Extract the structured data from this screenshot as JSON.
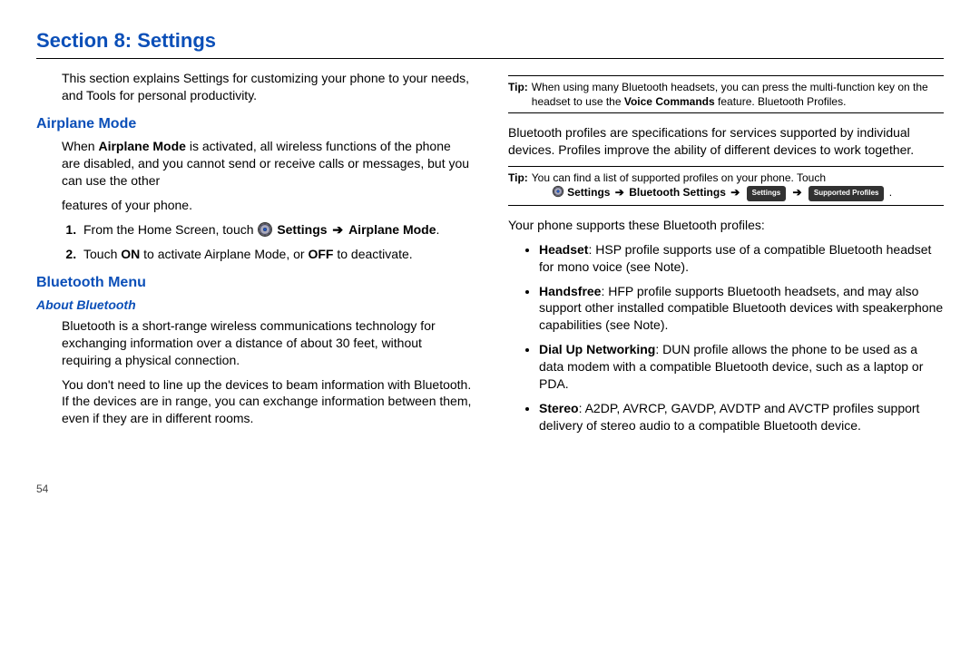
{
  "section_title": "Section 8: Settings",
  "intro": "This section explains Settings for customizing your phone to your needs, and Tools for personal productivity.",
  "left": {
    "airplane": {
      "heading": "Airplane Mode",
      "p1_a": "When ",
      "p1_b": "Airplane Mode",
      "p1_c": " is activated, all wireless functions of the phone are disabled, and you cannot send or receive calls or messages, but you can use the other",
      "p1_d": "features of your phone.",
      "step1_a": "From the Home Screen, touch ",
      "step1_b": "Settings",
      "step1_arrow": " ➔ ",
      "step1_c": "Airplane Mode",
      "step1_d": ".",
      "step2_a": "Touch ",
      "step2_b": "ON",
      "step2_c": " to activate Airplane Mode, or ",
      "step2_d": "OFF",
      "step2_e": " to deactivate."
    },
    "bluetooth": {
      "heading": "Bluetooth Menu",
      "sub": "About Bluetooth",
      "p1": "Bluetooth is a short-range wireless communications technology for exchanging information over a distance of about 30 feet, without requiring a physical connection.",
      "p2": "You don't need to line up the devices to beam information with Bluetooth. If the devices are in range, you can exchange information between them, even if they are in different rooms."
    }
  },
  "right": {
    "tip1_label": "Tip:",
    "tip1_a": "When using many Bluetooth headsets, you can press the multi-function key on the headset to use the ",
    "tip1_b": "Voice Commands",
    "tip1_c": " feature. Bluetooth Profiles.",
    "p1": "Bluetooth profiles are specifications for services supported by individual devices. Profiles improve the ability of different devices to work together.",
    "tip2_label": "Tip:",
    "tip2_a": "You can find a list of supported profiles on your phone. Touch",
    "tip2_b": "Settings",
    "tip2_arrow1": " ➔ ",
    "tip2_c": "Bluetooth Settings",
    "tip2_arrow2": " ➔ ",
    "tip2_chip1": "Settings",
    "tip2_arrow3": " ➔ ",
    "tip2_chip2": "Supported Profiles",
    "tip2_d": " .",
    "p2": "Your phone supports these Bluetooth profiles:",
    "bullets": {
      "b1a": "Headset",
      "b1b": ": HSP profile supports use of a compatible Bluetooth headset for mono voice (see Note).",
      "b2a": "Handsfree",
      "b2b": ": HFP profile supports Bluetooth headsets, and may also support other installed compatible Bluetooth devices with speakerphone capabilities (see Note).",
      "b3a": "Dial Up Networking",
      "b3b": ": DUN profile allows the phone to be used as a data modem with a compatible Bluetooth device, such as a laptop or PDA.",
      "b4a": "Stereo",
      "b4b": ": A2DP, AVRCP, GAVDP, AVDTP and AVCTP profiles support delivery of stereo audio to a compatible Bluetooth device."
    }
  },
  "page_number": "54"
}
